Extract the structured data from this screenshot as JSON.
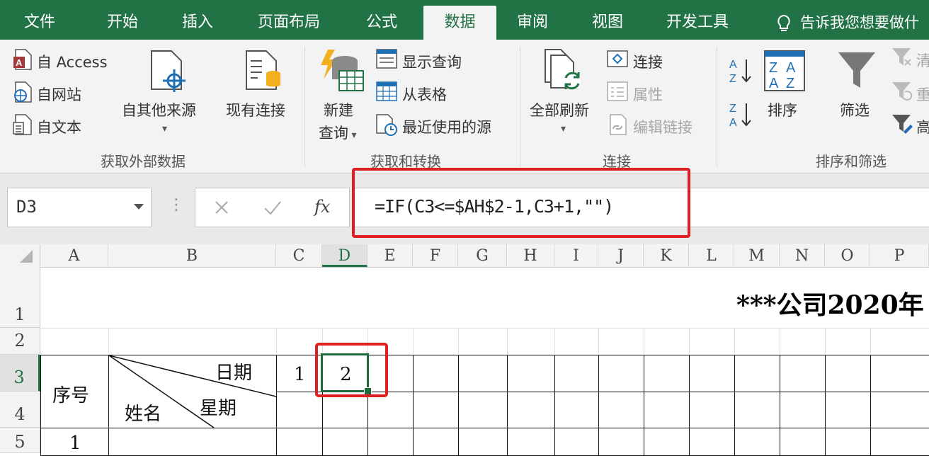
{
  "tabs": [
    {
      "label": "文件",
      "active": false
    },
    {
      "label": "开始",
      "active": false
    },
    {
      "label": "插入",
      "active": false
    },
    {
      "label": "页面布局",
      "active": false
    },
    {
      "label": "公式",
      "active": false
    },
    {
      "label": "数据",
      "active": true
    },
    {
      "label": "审阅",
      "active": false
    },
    {
      "label": "视图",
      "active": false
    },
    {
      "label": "开发工具",
      "active": false
    }
  ],
  "tell_me": "告诉我您想要做什",
  "ribbon": {
    "get_external": {
      "access": "自 Access",
      "web": "自网站",
      "text": "自文本",
      "other_sources": "自其他来源",
      "existing": "现有连接",
      "label": "获取外部数据"
    },
    "get_transform": {
      "new_query_1": "新建",
      "new_query_2": "查询",
      "show_queries": "显示查询",
      "from_table": "从表格",
      "recent_sources": "最近使用的源",
      "label": "获取和转换"
    },
    "connections": {
      "refresh_all": "全部刷新",
      "connections": "连接",
      "properties": "属性",
      "edit_links": "编辑链接",
      "label": "连接"
    },
    "sort_filter": {
      "sort": "排序",
      "filter": "筛选",
      "clear": "清",
      "reapply": "重",
      "advanced": "高",
      "label": "排序和筛选"
    }
  },
  "formula_bar": {
    "name_box": "D3",
    "fx": "fx",
    "formula": "=IF(C3<=$AH$2-1,C3+1,\"\")"
  },
  "sheet": {
    "columns": [
      "A",
      "B",
      "C",
      "D",
      "E",
      "F",
      "G",
      "H",
      "I",
      "J",
      "K",
      "L",
      "M",
      "N",
      "O",
      "P"
    ],
    "rows": [
      "1",
      "2",
      "3",
      "4",
      "5"
    ],
    "title": "***公司2020年",
    "a3": "序号",
    "b_date": "日期",
    "b_weekday": "星期",
    "b_name": "姓名",
    "c3": "1",
    "d3": "2",
    "a5": "1"
  },
  "colors": {
    "excel_green": "#217346",
    "highlight_red": "#e02020"
  }
}
